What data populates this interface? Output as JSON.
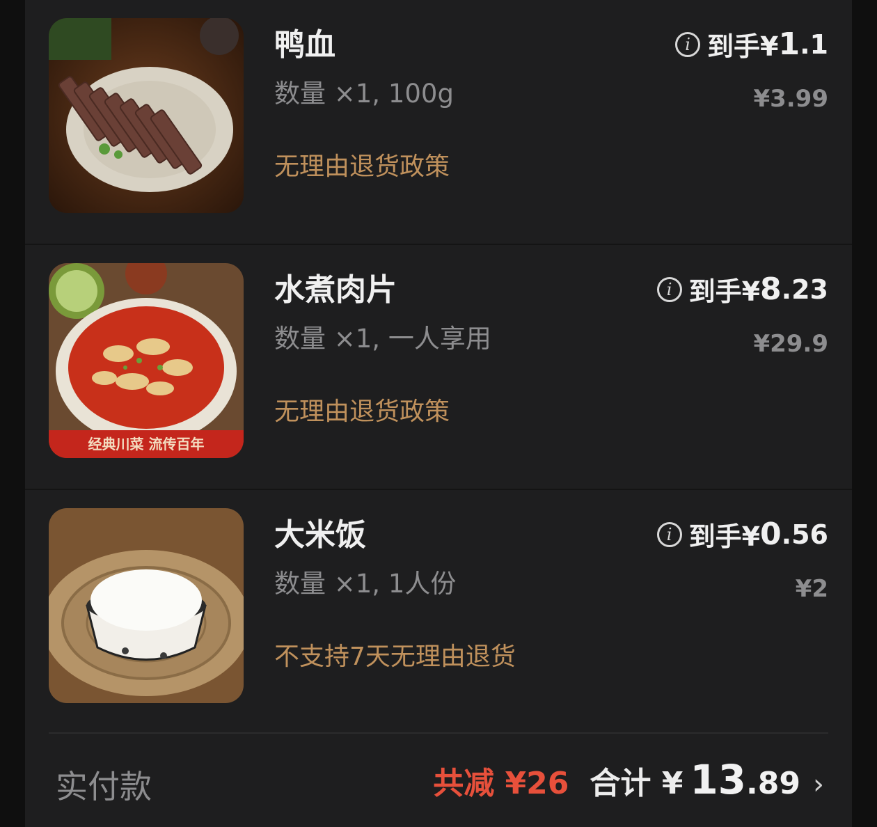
{
  "items": [
    {
      "name": "鸭血",
      "qty": "数量 ×1, 100g",
      "policy": "无理由退货政策",
      "price_prefix": "到手¥",
      "price_main": "1",
      "price_dec": ".1",
      "orig_price": "¥3.99",
      "image": "duck-blood-dish"
    },
    {
      "name": "水煮肉片",
      "qty": "数量 ×1, 一人享用",
      "policy": "无理由退货政策",
      "price_prefix": "到手¥",
      "price_main": "8",
      "price_dec": ".23",
      "orig_price": "¥29.9",
      "image": "boiled-pork-slices-dish",
      "image_banner": "经典川菜  流传百年"
    },
    {
      "name": "大米饭",
      "qty": "数量 ×1, 1人份",
      "policy": "不支持7天无理由退货",
      "price_prefix": "到手¥",
      "price_main": "0",
      "price_dec": ".56",
      "orig_price": "¥2",
      "image": "rice-bowl"
    }
  ],
  "footer": {
    "label": "实付款",
    "discount": "共减 ¥26",
    "total_label": "合计 ¥",
    "total_int": "13",
    "total_dec": ".89",
    "chevron": "›"
  },
  "colors": {
    "background": "#1e1e1f",
    "policy": "#c0915c",
    "discount": "#e7503b",
    "muted": "#8d8d8f"
  }
}
